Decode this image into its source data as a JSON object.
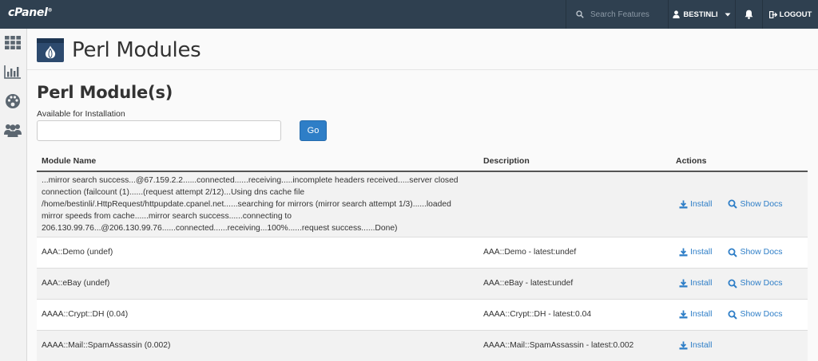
{
  "brand": {
    "logo_text": "cPanel",
    "logo_mark": "®"
  },
  "topbar": {
    "search_placeholder": "Search Features",
    "user_label": "BESTINLI",
    "logout_label": "LOGOUT"
  },
  "page": {
    "title": "Perl Modules",
    "section_title": "Perl Module(s)",
    "available_label": "Available for Installation",
    "available_value": "",
    "go_label": "Go"
  },
  "table": {
    "headers": {
      "name": "Module Name",
      "description": "Description",
      "actions": "Actions"
    },
    "install_label": "Install",
    "docs_label": "Show Docs",
    "rows": [
      {
        "name": "...mirror search success...@67.159.2.2......connected......receiving.....incomplete headers received.....server closed connection (failcount (1)......(request attempt 2/12)...Using dns cache file /home/bestinli/.HttpRequest/httpupdate.cpanel.net......searching for mirrors (mirror search attempt 1/3)......loaded mirror speeds from cache......mirror search success......connecting to 206.130.99.76...@206.130.99.76......connected......receiving...100%......request success......Done)",
        "description": ""
      },
      {
        "name": "AAA::Demo (undef)",
        "description": "AAA::Demo - latest:undef"
      },
      {
        "name": "AAA::eBay (undef)",
        "description": "AAA::eBay - latest:undef"
      },
      {
        "name": "AAAA::Crypt::DH (0.04)",
        "description": "AAAA::Crypt::DH - latest:0.04"
      },
      {
        "name": "AAAA::Mail::SpamAssassin (0.002)",
        "description": "AAAA::Mail::SpamAssassin - latest:0.002"
      }
    ]
  },
  "colors": {
    "topbar": "#2f4050",
    "accent": "#2e7ec7",
    "sidebar_icon": "#5b6670"
  },
  "icons": [
    "search-icon",
    "user-icon",
    "caret-down-icon",
    "bell-icon",
    "logout-icon",
    "grid-icon",
    "bar-chart-icon",
    "palette-icon",
    "users-icon",
    "perl-onion-icon",
    "download-icon",
    "magnifier-icon"
  ]
}
